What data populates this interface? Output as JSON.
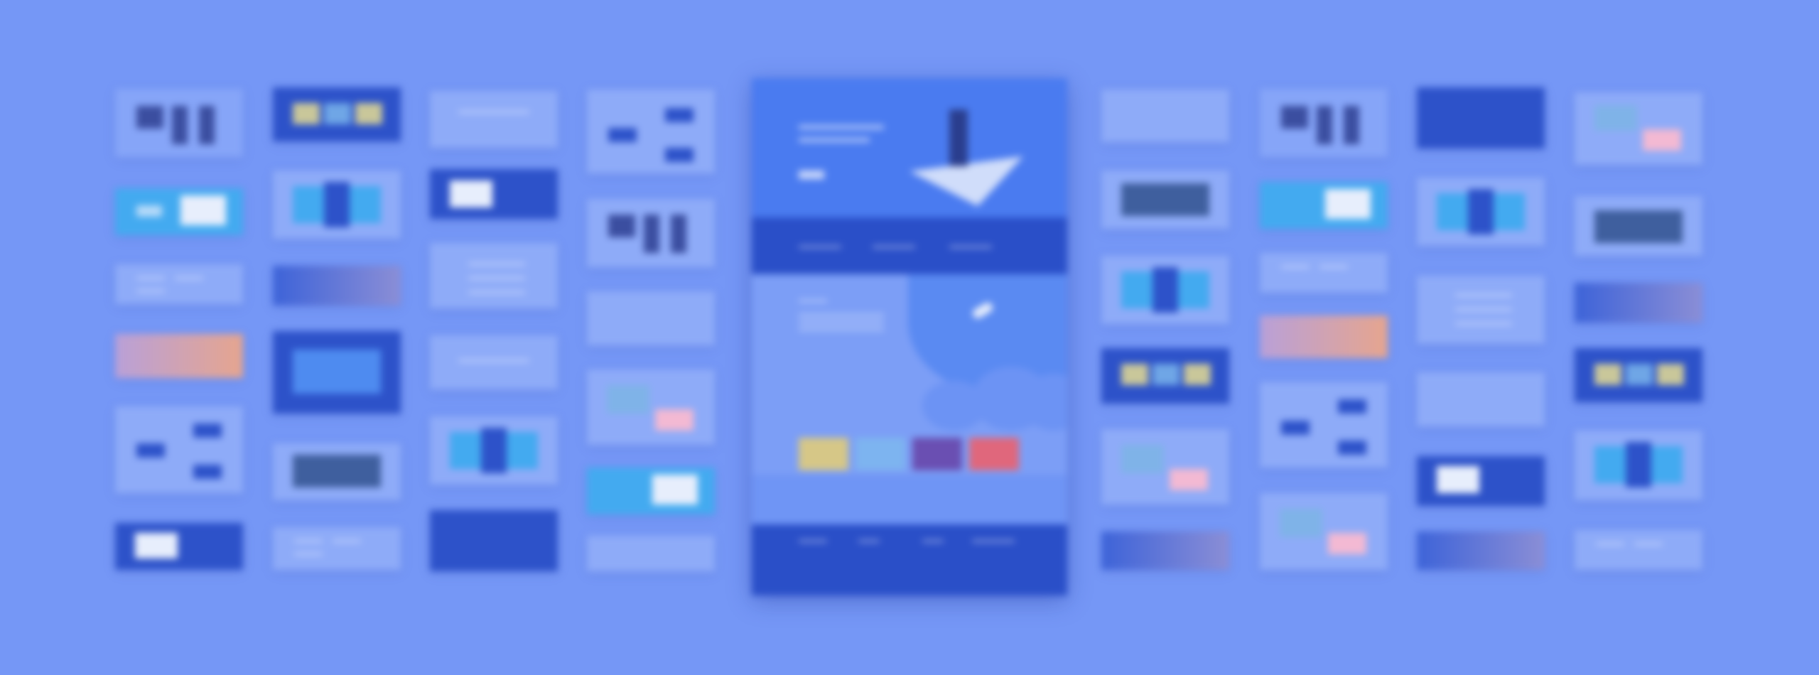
{
  "colors": {
    "background": "#7597f6",
    "panel_light": "#86a5f8",
    "panel_dark": "#2d52c9",
    "accent_cyan": "#43aaf0",
    "hero_blue": "#4a7bf0"
  },
  "gallery": {
    "description_visible_text": "",
    "center_page_visible_text": ""
  }
}
